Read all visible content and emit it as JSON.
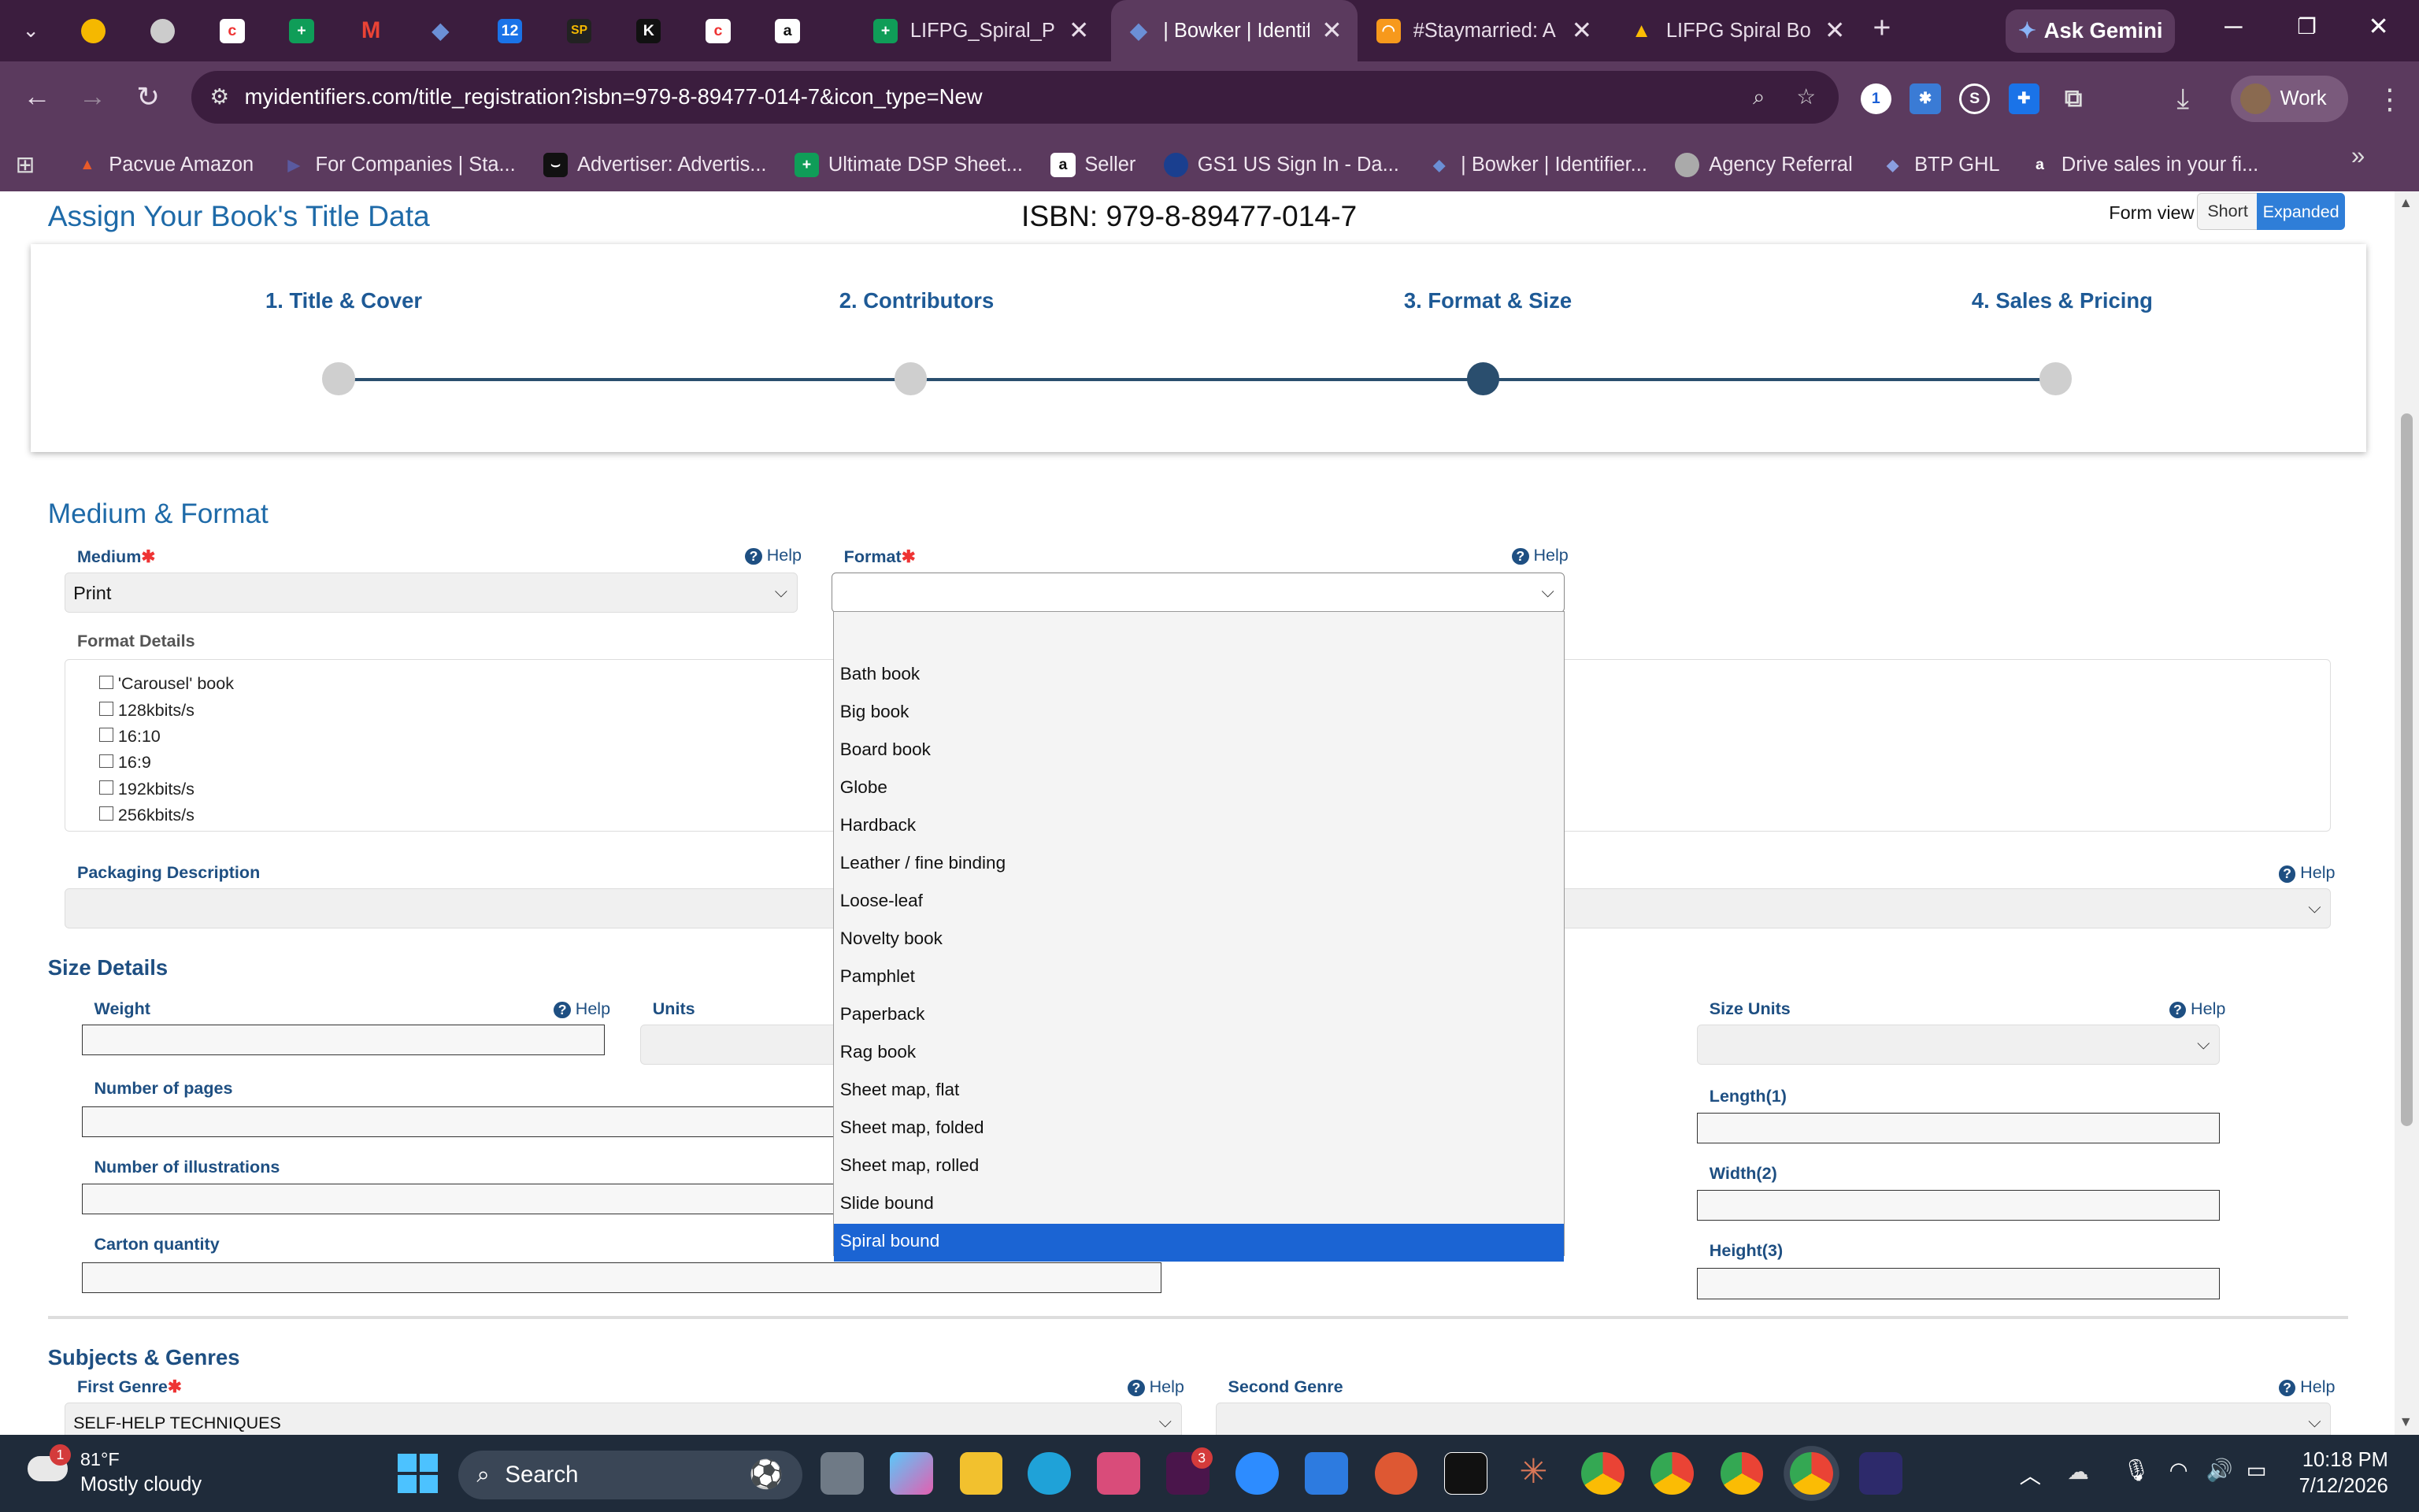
{
  "browser": {
    "tabs": [
      {
        "title": "LIFPG_Spiral_Pipe",
        "active": false
      },
      {
        "title": "| Bowker | Identif",
        "active": true
      },
      {
        "title": "#Staymarried: A",
        "active": false
      },
      {
        "title": "LIFPG Spiral Bou",
        "active": false
      }
    ],
    "new_tab": "+",
    "ask_gemini": "Ask Gemini",
    "url": "myidentifiers.com/title_registration?isbn=979-8-89477-014-7&icon_type=New",
    "profile": "Work",
    "bookmarks": [
      "Pacvue Amazon",
      "For Companies | Sta...",
      "Advertiser: Advertis...",
      "Ultimate DSP Sheet...",
      "Seller",
      "GS1 US Sign In - Da...",
      "| Bowker | Identifier...",
      "Agency Referral",
      "BTP GHL",
      "Drive sales in your fi..."
    ]
  },
  "page": {
    "title": "Assign Your Book's Title Data",
    "isbn": "ISBN: 979-8-89477-014-7",
    "form_view_label": "Form view",
    "form_view_short": "Short",
    "form_view_expanded": "Expanded",
    "steps": [
      "1. Title & Cover",
      "2. Contributors",
      "3. Format & Size",
      "4. Sales & Pricing"
    ],
    "active_step": 3,
    "medium_section": "Medium & Format",
    "medium_label": "Medium",
    "medium_value": "Print",
    "format_label": "Format",
    "format_value": "",
    "help": "Help",
    "format_details_label": "Format Details",
    "format_details": [
      "'Carousel' book",
      "128kbits/s",
      "16:10",
      "16:9",
      "192kbits/s",
      "256kbits/s"
    ],
    "packaging_label": "Packaging Description",
    "size_section": "Size Details",
    "weight_label": "Weight",
    "units_label": "Units",
    "size_units_label": "Size Units",
    "pages_label": "Number of pages",
    "illustrations_label": "Number of illustrations",
    "carton_label": "Carton quantity",
    "length_label": "Length(1)",
    "width_label": "Width(2)",
    "height_label": "Height(3)",
    "subjects_section": "Subjects & Genres",
    "first_genre_label": "First Genre",
    "first_genre_value": "SELF-HELP TECHNIQUES",
    "second_genre_label": "Second Genre",
    "format_options": [
      "Bath book",
      "Big book",
      "Board book",
      "Globe",
      "Hardback",
      "Leather / fine binding",
      "Loose-leaf",
      "Novelty book",
      "Pamphlet",
      "Paperback",
      "Rag book",
      "Sheet map, flat",
      "Sheet map, folded",
      "Sheet map, rolled",
      "Slide bound",
      "Spiral bound"
    ],
    "highlighted_option": "Spiral bound"
  },
  "taskbar": {
    "weather_temp": "81°F",
    "weather_desc": "Mostly cloudy",
    "weather_badge": "1",
    "search": "Search",
    "time": "10:18 PM",
    "date": "7/12/2026",
    "slack_badge": "3"
  },
  "colors": {
    "accent": "#1e6aa8",
    "tab_bar": "#3b1d3e",
    "toolbar": "#5b3a5e",
    "selected_option": "#1b64d3"
  }
}
